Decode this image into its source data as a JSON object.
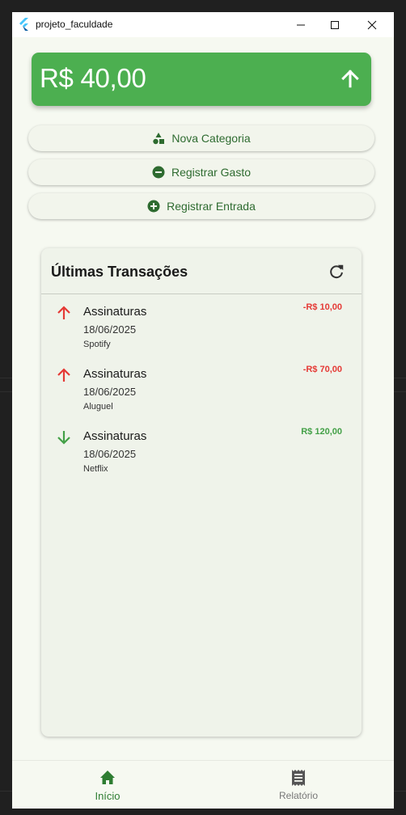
{
  "window": {
    "title": "projeto_faculdade"
  },
  "balance": {
    "amount": "R$ 40,00",
    "trend_icon": "arrow-up-icon"
  },
  "actions": [
    {
      "label": "Nova Categoria",
      "icon": "category-shapes-icon"
    },
    {
      "label": "Registrar Gasto",
      "icon": "minus-circle-icon"
    },
    {
      "label": "Registrar Entrada",
      "icon": "plus-circle-icon"
    }
  ],
  "transactions": {
    "title": "Últimas Transações",
    "refresh_icon": "refresh-icon",
    "items": [
      {
        "category": "Assinaturas",
        "date": "18/06/2025",
        "description": "Spotify",
        "amount": "-R$ 10,00",
        "direction": "up"
      },
      {
        "category": "Assinaturas",
        "date": "18/06/2025",
        "description": "Aluguel",
        "amount": "-R$ 70,00",
        "direction": "up"
      },
      {
        "category": "Assinaturas",
        "date": "18/06/2025",
        "description": "Netflix",
        "amount": "R$ 120,00",
        "direction": "down"
      }
    ]
  },
  "bottom_nav": {
    "items": [
      {
        "label": "Início",
        "icon": "home-icon",
        "active": true
      },
      {
        "label": "Relatório",
        "icon": "receipt-icon",
        "active": false
      }
    ]
  },
  "colors": {
    "accent": "#4caf50",
    "negative": "#e53935",
    "positive": "#43a047",
    "button_text": "#2e6b30"
  }
}
